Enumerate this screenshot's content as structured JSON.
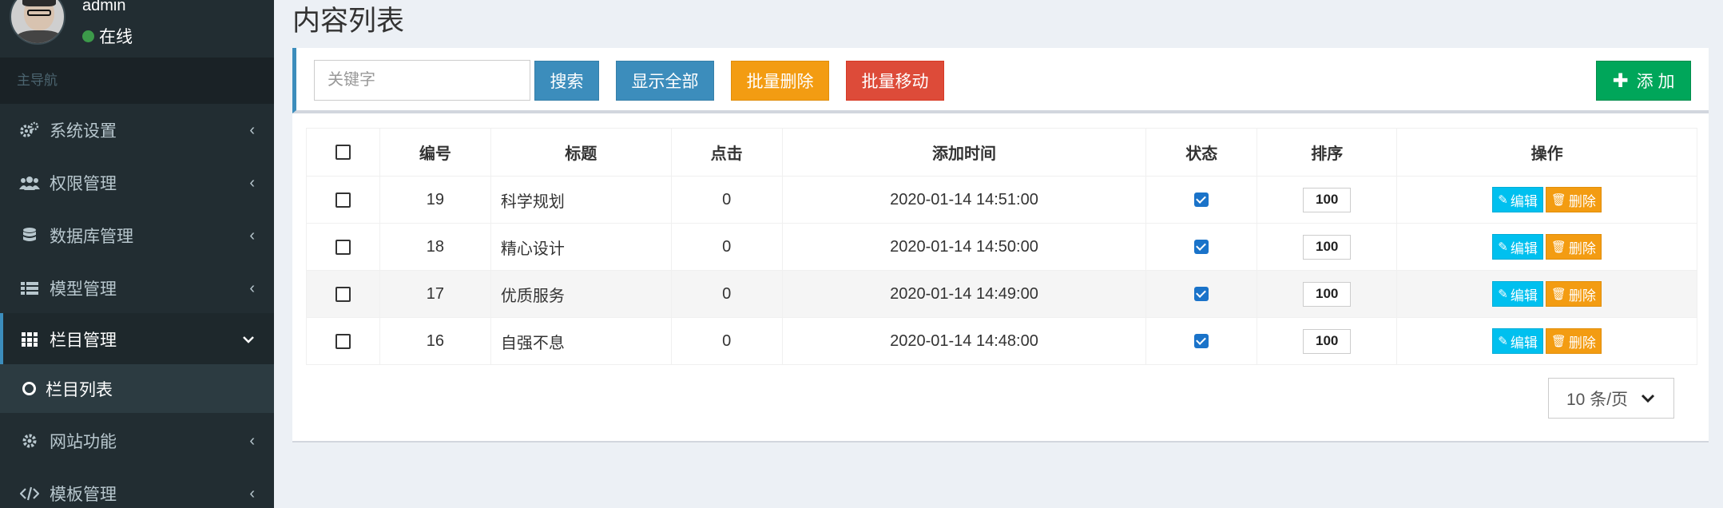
{
  "user": {
    "name": "admin",
    "status": "在线"
  },
  "sidebar": {
    "header": "主导航",
    "items": [
      {
        "label": "系统设置",
        "icon": "cogs-icon"
      },
      {
        "label": "权限管理",
        "icon": "users-icon"
      },
      {
        "label": "数据库管理",
        "icon": "database-icon"
      },
      {
        "label": "模型管理",
        "icon": "list-icon"
      },
      {
        "label": "栏目管理",
        "icon": "grid-icon"
      },
      {
        "label": "网站功能",
        "icon": "gear-icon"
      },
      {
        "label": "模板管理",
        "icon": "code-icon"
      }
    ],
    "submenu": {
      "label": "栏目列表"
    }
  },
  "page": {
    "title": "内容列表"
  },
  "toolbar": {
    "search_placeholder": "关键字",
    "search_label": "搜索",
    "show_all_label": "显示全部",
    "batch_delete_label": "批量删除",
    "batch_move_label": "批量移动",
    "add_label": "添 加"
  },
  "table": {
    "headers": [
      "编号",
      "标题",
      "点击",
      "添加时间",
      "状态",
      "排序",
      "操作"
    ],
    "rows": [
      {
        "id": "19",
        "title": "科学规划",
        "clicks": "0",
        "time": "2020-01-14 14:51:00",
        "status_checked": true,
        "sort": "100"
      },
      {
        "id": "18",
        "title": "精心设计",
        "clicks": "0",
        "time": "2020-01-14 14:50:00",
        "status_checked": true,
        "sort": "100"
      },
      {
        "id": "17",
        "title": "优质服务",
        "clicks": "0",
        "time": "2020-01-14 14:49:00",
        "status_checked": true,
        "sort": "100"
      },
      {
        "id": "16",
        "title": "自强不息",
        "clicks": "0",
        "time": "2020-01-14 14:48:00",
        "status_checked": true,
        "sort": "100"
      }
    ],
    "edit_label": "编辑",
    "delete_label": "删除"
  },
  "pager": {
    "label": "10 条/页"
  },
  "colors": {
    "sidebar_bg": "#222d32",
    "primary": "#3c8dbc",
    "warning": "#f39c12",
    "danger": "#dd4b39",
    "success": "#00a65a",
    "info": "#00c0ef"
  }
}
